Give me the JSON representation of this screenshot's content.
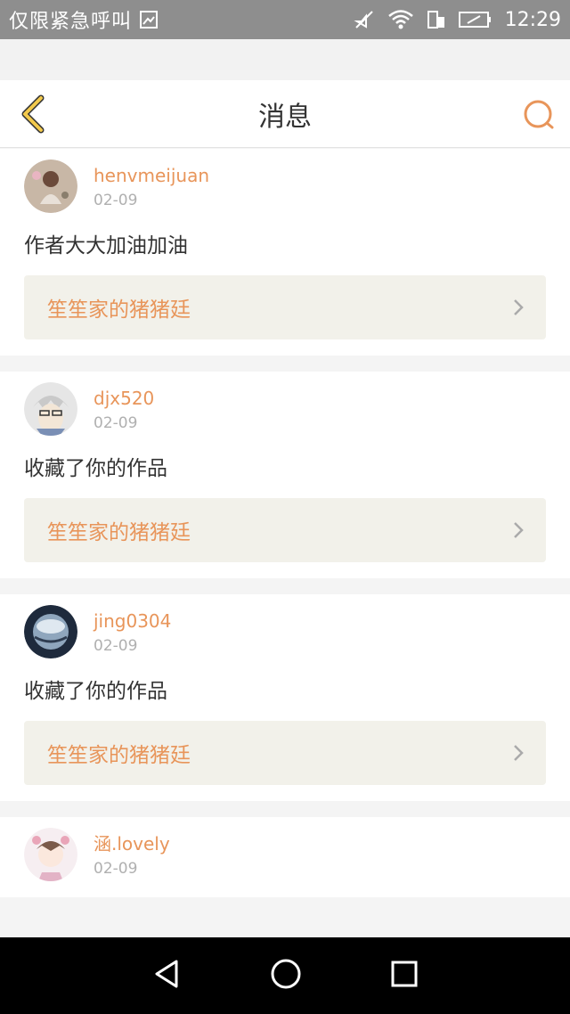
{
  "status_bar": {
    "carrier_text": "仅限紧急呼叫",
    "time": "12:29",
    "icons": [
      "sim-icon",
      "mute-icon",
      "wifi-icon",
      "data-icon",
      "battery-icon"
    ]
  },
  "header": {
    "title": "消息",
    "back_icon": "chevron-left-icon",
    "search_icon": "search-icon",
    "accent": "#e8955a",
    "back_color": "#f2c94c"
  },
  "messages": [
    {
      "user": "henvmeijuan",
      "date": "02-09",
      "text": "作者大大加油加油",
      "work": "笙笙家的猪猪廷"
    },
    {
      "user": "djx520",
      "date": "02-09",
      "text": "收藏了你的作品",
      "work": "笙笙家的猪猪廷"
    },
    {
      "user": "jing0304",
      "date": "02-09",
      "text": "收藏了你的作品",
      "work": "笙笙家的猪猪廷"
    },
    {
      "user": "涵.lovely",
      "date": "02-09",
      "text": "",
      "work": ""
    }
  ],
  "system_nav": [
    "back-triangle-icon",
    "home-circle-icon",
    "recents-square-icon"
  ]
}
